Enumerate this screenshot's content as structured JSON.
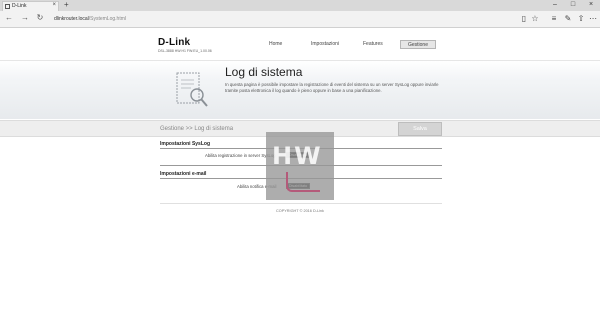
{
  "browser": {
    "tab_title": "D-Link",
    "tab_close": "×",
    "new_tab": "+",
    "url_host": "dlinkrouter.local",
    "url_path": "/SystemLog.html",
    "window_controls": {
      "minimize": "–",
      "maximize": "□",
      "close": "×"
    },
    "nav": {
      "back": "←",
      "forward": "→",
      "refresh": "↻"
    },
    "toolbar_icons": [
      "reading-view-icon",
      "favorite-star-icon",
      "hub-icon",
      "web-note-icon",
      "share-icon",
      "more-icon"
    ],
    "toolbar_glyphs": [
      "▯",
      "☆",
      "≡",
      "✎",
      "⇧",
      "⋯"
    ]
  },
  "header": {
    "logo": "D-Link",
    "device_info": "DSL-3888   HW:H1   FW:EU_1.00.06"
  },
  "menu": {
    "home": "Home",
    "impostazioni": "Impostazioni",
    "features": "Features",
    "gestione": "Gestione"
  },
  "banner": {
    "title": "Log di sistema",
    "description": "In questa pagina è possibile impostare la registrazione di eventi del sistema su un server SysLog oppure inviarle tramite posta elettronica il log quando è pieno oppure in base a una pianificazione."
  },
  "bar": {
    "breadcrumb": "Gestione >> Log di sistema",
    "save_label": "Salva"
  },
  "syslog": {
    "title": "Impostazioni SysLog",
    "enable_label": "Abilita registrazione in server SysLog",
    "toggle_value": "Disabilitato"
  },
  "email": {
    "title": "Impostazioni e-mail",
    "enable_label": "Abilita notifica e-mail",
    "toggle_value": "Disabilitato"
  },
  "watermark_text": "HW",
  "footer": {
    "copyright": "COPYRIGHT © 2016 D-Link"
  },
  "colors": {
    "accent_pink": "#b45a7a",
    "bar_gray": "#eeeeee",
    "save_button": "#d4d4d4"
  }
}
